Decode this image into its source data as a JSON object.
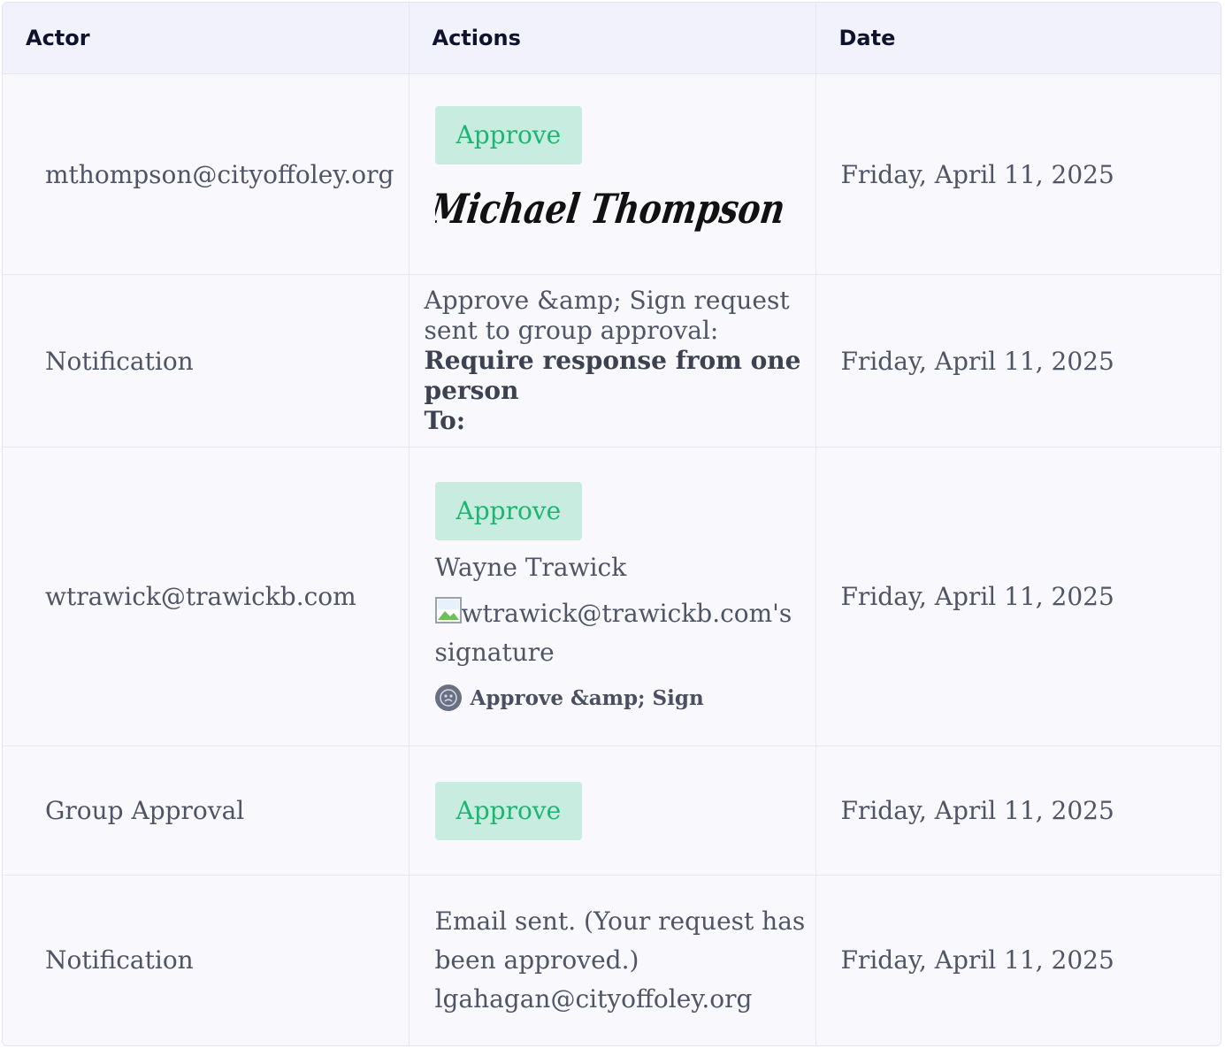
{
  "headers": {
    "actor": "Actor",
    "actions": "Actions",
    "date": "Date"
  },
  "rows": [
    {
      "actor": "mthompson@cityoffoley.org",
      "badge": "Approve",
      "signature_name": "Michael Thompson",
      "date": "Friday, April 11, 2025"
    },
    {
      "actor": "Notification",
      "line1": "Approve &amp; Sign request sent to group approval:",
      "line2": "Require response from one person",
      "line3": "To:",
      "date": "Friday, April 11, 2025"
    },
    {
      "actor": "wtrawick@trawickb.com",
      "badge": "Approve",
      "name": "Wayne Trawick",
      "image_alt": "wtrawick@trawickb.com's signature",
      "meta": "Approve &amp; Sign",
      "date": "Friday, April 11, 2025"
    },
    {
      "actor": "Group Approval",
      "badge": "Approve",
      "date": "Friday, April 11, 2025"
    },
    {
      "actor": "Notification",
      "text": "Email sent. (Your request has been approved.) lgahagan@cityoffoley.org",
      "date": "Friday, April 11, 2025"
    }
  ],
  "colors": {
    "badge_bg": "#c8ede0",
    "badge_text": "#1cb572",
    "header_bg": "#f2f2fc"
  }
}
